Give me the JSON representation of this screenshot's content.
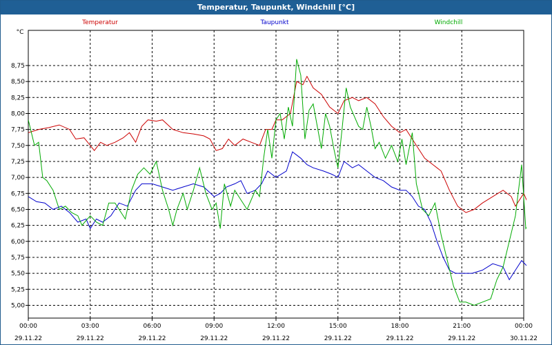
{
  "window": {
    "title": "Temperatur, Taupunkt, Windchill [°C]"
  },
  "chart_data": {
    "type": "line",
    "title": "Temperatur, Taupunkt, Windchill [°C]",
    "ylabel": "°C",
    "ylim": [
      4.8,
      9.3
    ],
    "xlim": [
      0,
      24
    ],
    "grid": true,
    "legend": "top",
    "y_ticks": [
      {
        "value": 5.0,
        "label": "5,00"
      },
      {
        "value": 5.25,
        "label": "5,25"
      },
      {
        "value": 5.5,
        "label": "5,50"
      },
      {
        "value": 5.75,
        "label": "5,75"
      },
      {
        "value": 6.0,
        "label": "6,00"
      },
      {
        "value": 6.25,
        "label": "6,25"
      },
      {
        "value": 6.5,
        "label": "6,50"
      },
      {
        "value": 6.75,
        "label": "6,75"
      },
      {
        "value": 7.0,
        "label": "7,00"
      },
      {
        "value": 7.25,
        "label": "7,25"
      },
      {
        "value": 7.5,
        "label": "7,50"
      },
      {
        "value": 7.75,
        "label": "7,75"
      },
      {
        "value": 8.0,
        "label": "8,00"
      },
      {
        "value": 8.25,
        "label": "8,25"
      },
      {
        "value": 8.5,
        "label": "8,50"
      },
      {
        "value": 8.75,
        "label": "8,75"
      }
    ],
    "x_ticks": [
      {
        "value": 0,
        "time": "00:00",
        "date": "29.11.22"
      },
      {
        "value": 3,
        "time": "03:00",
        "date": "29.11.22"
      },
      {
        "value": 6,
        "time": "06:00",
        "date": "29.11.22"
      },
      {
        "value": 9,
        "time": "09:00",
        "date": "29.11.22"
      },
      {
        "value": 12,
        "time": "12:00",
        "date": "29.11.22"
      },
      {
        "value": 15,
        "time": "15:00",
        "date": "29.11.22"
      },
      {
        "value": 18,
        "time": "18:00",
        "date": "29.11.22"
      },
      {
        "value": 21,
        "time": "21:00",
        "date": "29.11.22"
      },
      {
        "value": 24,
        "time": "00:00",
        "date": "30.11.22"
      }
    ],
    "series": [
      {
        "name": "Temperatur",
        "color": "#cc0000",
        "points": [
          [
            0,
            7.7
          ],
          [
            0.5,
            7.75
          ],
          [
            1,
            7.78
          ],
          [
            1.5,
            7.82
          ],
          [
            2,
            7.75
          ],
          [
            2.3,
            7.6
          ],
          [
            2.7,
            7.62
          ],
          [
            3,
            7.5
          ],
          [
            3.2,
            7.42
          ],
          [
            3.5,
            7.55
          ],
          [
            3.8,
            7.5
          ],
          [
            4.2,
            7.55
          ],
          [
            4.6,
            7.62
          ],
          [
            4.9,
            7.7
          ],
          [
            5.2,
            7.55
          ],
          [
            5.5,
            7.8
          ],
          [
            5.8,
            7.9
          ],
          [
            6.2,
            7.88
          ],
          [
            6.5,
            7.9
          ],
          [
            7,
            7.75
          ],
          [
            7.5,
            7.7
          ],
          [
            8,
            7.68
          ],
          [
            8.5,
            7.65
          ],
          [
            8.8,
            7.6
          ],
          [
            9.1,
            7.42
          ],
          [
            9.4,
            7.45
          ],
          [
            9.7,
            7.6
          ],
          [
            10,
            7.5
          ],
          [
            10.4,
            7.6
          ],
          [
            10.8,
            7.55
          ],
          [
            11.2,
            7.5
          ],
          [
            11.5,
            7.75
          ],
          [
            11.8,
            7.75
          ],
          [
            12,
            7.9
          ],
          [
            12.3,
            7.9
          ],
          [
            12.7,
            8.0
          ],
          [
            13,
            8.5
          ],
          [
            13.3,
            8.45
          ],
          [
            13.5,
            8.58
          ],
          [
            13.8,
            8.4
          ],
          [
            14.2,
            8.3
          ],
          [
            14.6,
            8.1
          ],
          [
            15,
            8.0
          ],
          [
            15.3,
            8.2
          ],
          [
            15.7,
            8.25
          ],
          [
            16,
            8.2
          ],
          [
            16.4,
            8.25
          ],
          [
            16.8,
            8.15
          ],
          [
            17.2,
            7.95
          ],
          [
            17.6,
            7.8
          ],
          [
            18,
            7.7
          ],
          [
            18.3,
            7.75
          ],
          [
            18.6,
            7.6
          ],
          [
            18.9,
            7.45
          ],
          [
            19.2,
            7.3
          ],
          [
            19.6,
            7.2
          ],
          [
            20,
            7.1
          ],
          [
            20.4,
            6.8
          ],
          [
            20.8,
            6.55
          ],
          [
            21.2,
            6.45
          ],
          [
            21.6,
            6.5
          ],
          [
            22,
            6.6
          ],
          [
            22.5,
            6.7
          ],
          [
            23,
            6.8
          ],
          [
            23.4,
            6.7
          ],
          [
            23.6,
            6.55
          ],
          [
            24,
            6.75
          ],
          [
            24.2,
            6.6
          ]
        ]
      },
      {
        "name": "Taupunkt",
        "color": "#0000cc",
        "points": [
          [
            0,
            6.7
          ],
          [
            0.4,
            6.62
          ],
          [
            0.8,
            6.6
          ],
          [
            1.2,
            6.5
          ],
          [
            1.6,
            6.55
          ],
          [
            2,
            6.45
          ],
          [
            2.4,
            6.3
          ],
          [
            2.8,
            6.35
          ],
          [
            3,
            6.2
          ],
          [
            3.3,
            6.35
          ],
          [
            3.6,
            6.3
          ],
          [
            4,
            6.4
          ],
          [
            4.4,
            6.6
          ],
          [
            4.8,
            6.55
          ],
          [
            5.2,
            6.8
          ],
          [
            5.5,
            6.9
          ],
          [
            6,
            6.9
          ],
          [
            6.5,
            6.85
          ],
          [
            7,
            6.8
          ],
          [
            7.5,
            6.85
          ],
          [
            8,
            6.9
          ],
          [
            8.5,
            6.85
          ],
          [
            9,
            6.7
          ],
          [
            9.3,
            6.75
          ],
          [
            9.6,
            6.85
          ],
          [
            10,
            6.9
          ],
          [
            10.3,
            6.95
          ],
          [
            10.6,
            6.75
          ],
          [
            11,
            6.8
          ],
          [
            11.3,
            6.9
          ],
          [
            11.6,
            7.1
          ],
          [
            12,
            7.0
          ],
          [
            12.5,
            7.1
          ],
          [
            12.8,
            7.4
          ],
          [
            13.2,
            7.3
          ],
          [
            13.5,
            7.2
          ],
          [
            13.8,
            7.15
          ],
          [
            14.3,
            7.1
          ],
          [
            14.7,
            7.05
          ],
          [
            15,
            7.0
          ],
          [
            15.3,
            7.25
          ],
          [
            15.7,
            7.15
          ],
          [
            16,
            7.2
          ],
          [
            16.4,
            7.1
          ],
          [
            16.8,
            7.0
          ],
          [
            17.2,
            6.95
          ],
          [
            17.6,
            6.85
          ],
          [
            18,
            6.8
          ],
          [
            18.3,
            6.8
          ],
          [
            18.6,
            6.7
          ],
          [
            18.9,
            6.55
          ],
          [
            19.2,
            6.5
          ],
          [
            19.5,
            6.3
          ],
          [
            19.8,
            6.0
          ],
          [
            20.1,
            5.75
          ],
          [
            20.4,
            5.55
          ],
          [
            20.7,
            5.5
          ],
          [
            21,
            5.5
          ],
          [
            21.5,
            5.5
          ],
          [
            22,
            5.55
          ],
          [
            22.5,
            5.65
          ],
          [
            23,
            5.6
          ],
          [
            23.3,
            5.4
          ],
          [
            23.6,
            5.55
          ],
          [
            23.9,
            5.7
          ],
          [
            24.2,
            5.6
          ]
        ]
      },
      {
        "name": "Windchill",
        "color": "#00aa00",
        "points": [
          [
            0,
            7.9
          ],
          [
            0.3,
            7.5
          ],
          [
            0.5,
            7.55
          ],
          [
            0.7,
            7.0
          ],
          [
            0.9,
            6.95
          ],
          [
            1.2,
            6.8
          ],
          [
            1.5,
            6.5
          ],
          [
            1.8,
            6.55
          ],
          [
            2.1,
            6.45
          ],
          [
            2.4,
            6.4
          ],
          [
            2.6,
            6.25
          ],
          [
            3,
            6.4
          ],
          [
            3.3,
            6.3
          ],
          [
            3.6,
            6.25
          ],
          [
            3.9,
            6.6
          ],
          [
            4.2,
            6.6
          ],
          [
            4.5,
            6.45
          ],
          [
            4.7,
            6.35
          ],
          [
            5.0,
            6.8
          ],
          [
            5.3,
            7.05
          ],
          [
            5.6,
            7.15
          ],
          [
            5.9,
            7.05
          ],
          [
            6.2,
            7.25
          ],
          [
            6.5,
            6.8
          ],
          [
            6.8,
            6.5
          ],
          [
            7.0,
            6.25
          ],
          [
            7.2,
            6.5
          ],
          [
            7.5,
            6.75
          ],
          [
            7.7,
            6.5
          ],
          [
            8.0,
            6.8
          ],
          [
            8.3,
            7.15
          ],
          [
            8.6,
            6.75
          ],
          [
            8.9,
            6.5
          ],
          [
            9.1,
            6.6
          ],
          [
            9.3,
            6.2
          ],
          [
            9.5,
            6.9
          ],
          [
            9.8,
            6.55
          ],
          [
            10.0,
            6.8
          ],
          [
            10.3,
            6.65
          ],
          [
            10.6,
            6.5
          ],
          [
            11.0,
            6.8
          ],
          [
            11.2,
            6.7
          ],
          [
            11.4,
            7.3
          ],
          [
            11.6,
            7.75
          ],
          [
            11.8,
            7.3
          ],
          [
            12.0,
            7.9
          ],
          [
            12.2,
            8.0
          ],
          [
            12.4,
            7.6
          ],
          [
            12.6,
            8.1
          ],
          [
            12.8,
            7.8
          ],
          [
            13.0,
            8.85
          ],
          [
            13.2,
            8.6
          ],
          [
            13.4,
            7.6
          ],
          [
            13.6,
            8.05
          ],
          [
            13.8,
            8.15
          ],
          [
            14.0,
            7.8
          ],
          [
            14.2,
            7.45
          ],
          [
            14.4,
            8.0
          ],
          [
            14.6,
            7.8
          ],
          [
            14.8,
            7.45
          ],
          [
            15.0,
            7.15
          ],
          [
            15.2,
            7.75
          ],
          [
            15.4,
            8.4
          ],
          [
            15.6,
            8.1
          ],
          [
            15.8,
            7.95
          ],
          [
            16.0,
            7.8
          ],
          [
            16.2,
            7.75
          ],
          [
            16.4,
            8.1
          ],
          [
            16.6,
            7.8
          ],
          [
            16.8,
            7.45
          ],
          [
            17.0,
            7.55
          ],
          [
            17.3,
            7.3
          ],
          [
            17.6,
            7.5
          ],
          [
            17.9,
            7.25
          ],
          [
            18.1,
            7.6
          ],
          [
            18.3,
            7.2
          ],
          [
            18.6,
            7.7
          ],
          [
            18.8,
            6.9
          ],
          [
            19.1,
            6.5
          ],
          [
            19.4,
            6.4
          ],
          [
            19.7,
            6.6
          ],
          [
            20.0,
            6.1
          ],
          [
            20.3,
            5.7
          ],
          [
            20.6,
            5.3
          ],
          [
            20.9,
            5.05
          ],
          [
            21.2,
            5.05
          ],
          [
            21.6,
            5.0
          ],
          [
            22.0,
            5.05
          ],
          [
            22.4,
            5.1
          ],
          [
            22.7,
            5.4
          ],
          [
            23.0,
            5.6
          ],
          [
            23.3,
            6.0
          ],
          [
            23.6,
            6.4
          ],
          [
            23.9,
            7.2
          ],
          [
            24.1,
            6.2
          ],
          [
            24.3,
            6.3
          ]
        ]
      }
    ]
  }
}
